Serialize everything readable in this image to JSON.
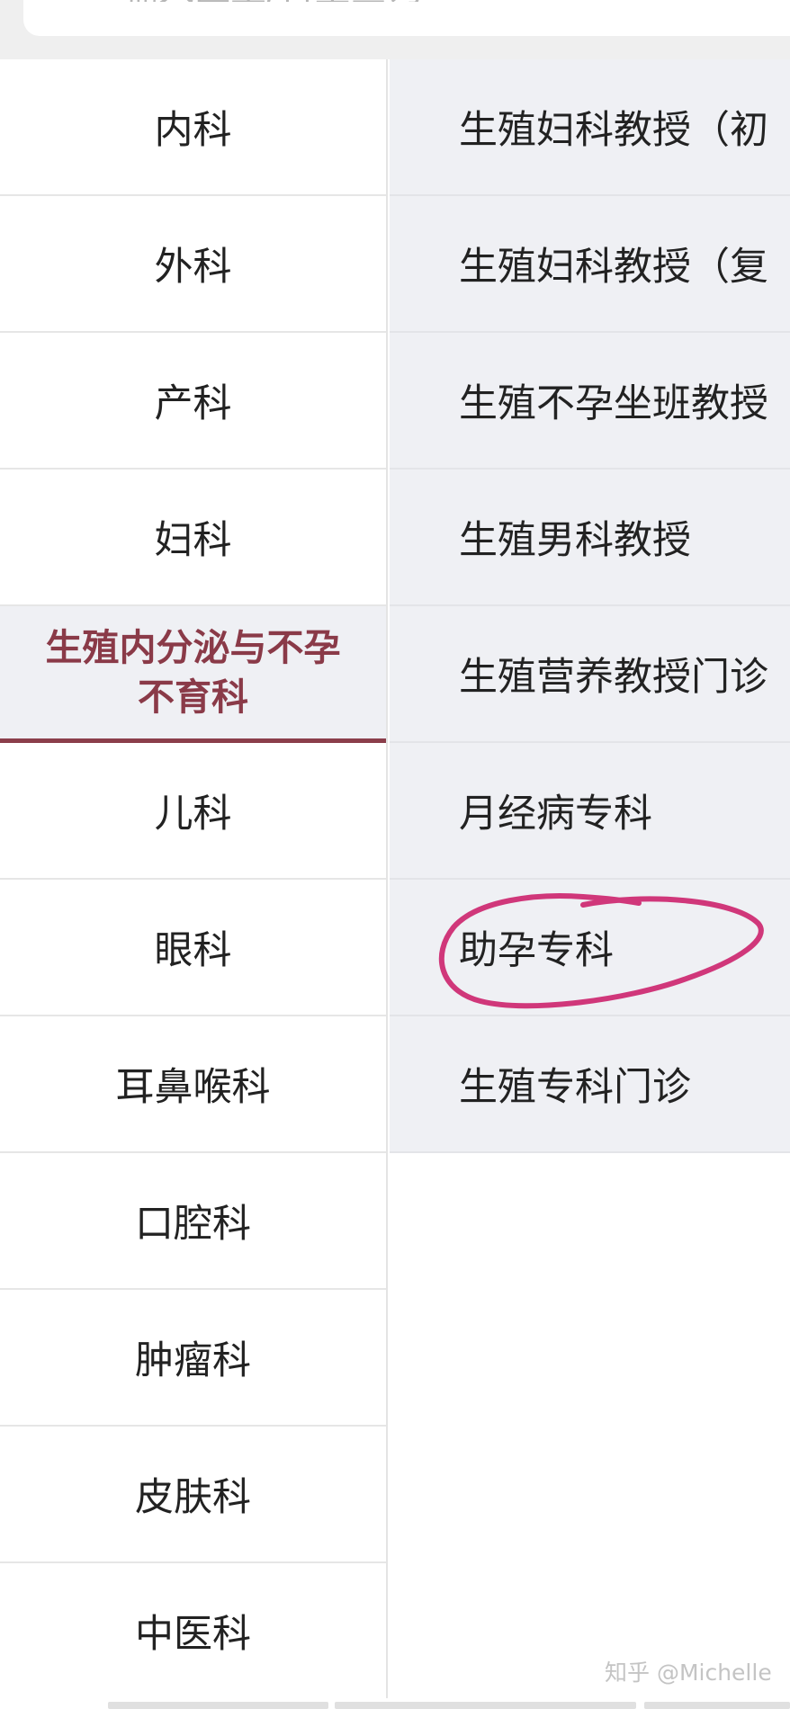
{
  "search": {
    "placeholder": "输入医生/科室查询"
  },
  "departments": [
    {
      "label": "内科"
    },
    {
      "label": "外科"
    },
    {
      "label": "产科"
    },
    {
      "label": "妇科"
    },
    {
      "label": "生殖内分泌与不孕不育科",
      "active": true
    },
    {
      "label": "儿科"
    },
    {
      "label": "眼科"
    },
    {
      "label": "耳鼻喉科"
    },
    {
      "label": "口腔科"
    },
    {
      "label": "肿瘤科"
    },
    {
      "label": "皮肤科"
    },
    {
      "label": "中医科"
    }
  ],
  "sub_departments": [
    {
      "label": "生殖妇科教授（初"
    },
    {
      "label": "生殖妇科教授（复"
    },
    {
      "label": "生殖不孕坐班教授"
    },
    {
      "label": "生殖男科教授"
    },
    {
      "label": "生殖营养教授门诊"
    },
    {
      "label": "月经病专科"
    },
    {
      "label": "助孕专科",
      "highlighted": true
    },
    {
      "label": "生殖专科门诊"
    }
  ],
  "colors": {
    "accent": "#8b3e4b",
    "annotation": "#d0377a",
    "panel": "#eff0f4"
  },
  "watermark": "知乎 @Michelle"
}
